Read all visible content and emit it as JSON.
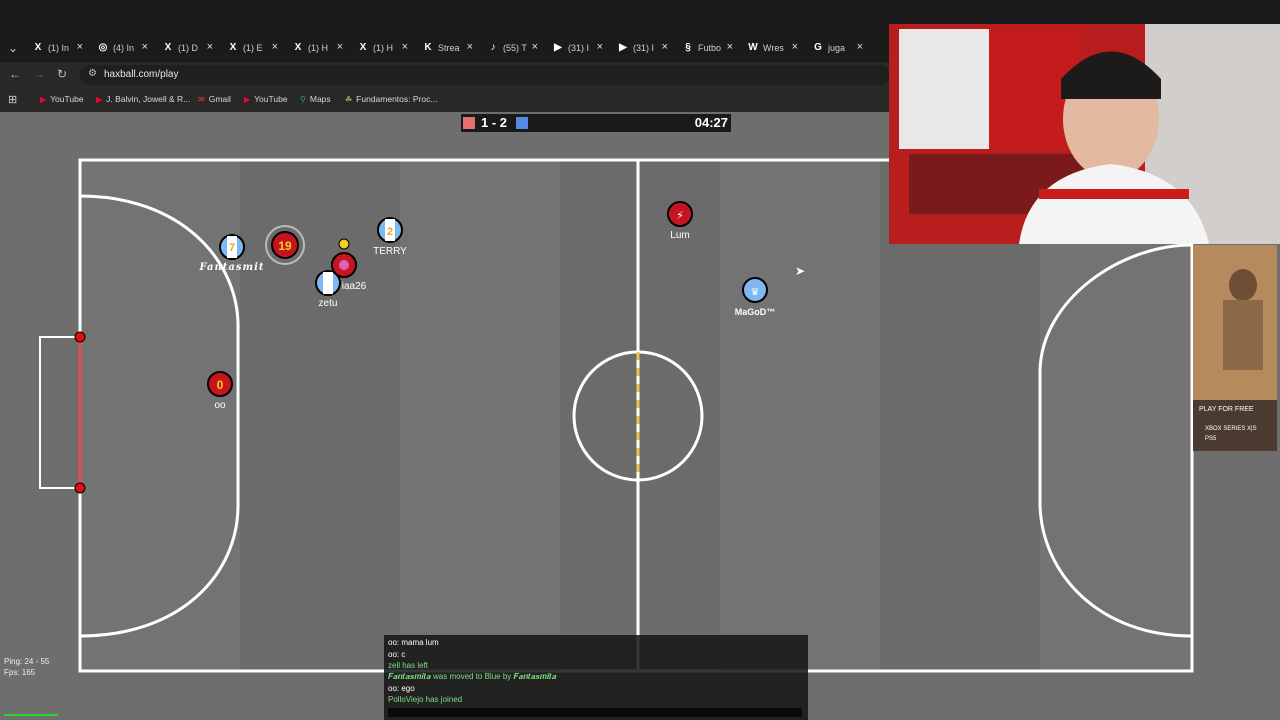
{
  "browser": {
    "tabs": [
      {
        "icon": "x-icon",
        "glyph": "X",
        "label": "(1) In"
      },
      {
        "icon": "instagram-icon",
        "glyph": "◎",
        "label": "(4) In"
      },
      {
        "icon": "x-icon",
        "glyph": "X",
        "label": "(1) D"
      },
      {
        "icon": "x-icon",
        "glyph": "X",
        "label": "(1) E"
      },
      {
        "icon": "x-icon",
        "glyph": "X",
        "label": "(1) H"
      },
      {
        "icon": "x-icon",
        "glyph": "X",
        "label": "(1) H"
      },
      {
        "icon": "kick-icon",
        "glyph": "K",
        "label": "Strea"
      },
      {
        "icon": "tiktok-icon",
        "glyph": "♪",
        "label": "(55) T"
      },
      {
        "icon": "youtube-icon",
        "glyph": "▶",
        "label": "(31) I"
      },
      {
        "icon": "youtube-icon",
        "glyph": "▶",
        "label": "(31) I"
      },
      {
        "icon": "link-icon",
        "glyph": "§",
        "label": "Futbo"
      },
      {
        "icon": "wrestling-icon",
        "glyph": "W",
        "label": "Wres"
      },
      {
        "icon": "google-icon",
        "glyph": "G",
        "label": "juga"
      }
    ],
    "url": "haxball.com/play",
    "bookmarks": [
      {
        "icon": "youtube-icon",
        "label": "YouTube"
      },
      {
        "icon": "youtube-icon",
        "label": "J. Balvin, Jowell & R..."
      },
      {
        "icon": "gmail-icon",
        "label": "Gmail"
      },
      {
        "icon": "youtube-icon",
        "label": "YouTube"
      },
      {
        "icon": "maps-icon",
        "label": "Maps"
      },
      {
        "icon": "bookmark-icon",
        "label": "Fundamentos: Proc..."
      }
    ]
  },
  "scoreboard": {
    "score": "1 - 2",
    "time": "04:27",
    "red_color": "#e56e6e",
    "blue_color": "#5689e5"
  },
  "players": [
    {
      "name": "Fantasmit",
      "team": "blue",
      "number": "7",
      "style": "italic"
    },
    {
      "name": "",
      "team": "red",
      "number": "19"
    },
    {
      "name": "TERRY",
      "team": "blue",
      "number": "2"
    },
    {
      "name": "zetu",
      "team": "blue",
      "number": ""
    },
    {
      "name": "iaa26",
      "team": "red",
      "number": ""
    },
    {
      "name": "Lum",
      "team": "red",
      "number": "⚡"
    },
    {
      "name": "MaGoD™",
      "team": "blue",
      "number": "♛",
      "style": "bold"
    },
    {
      "name": "oo",
      "team": "red",
      "number": "0"
    }
  ],
  "chat": [
    {
      "text": "oo: mama lum",
      "type": "msg"
    },
    {
      "text": "oo: c",
      "type": "msg"
    },
    {
      "text": "zell has left",
      "type": "sys"
    },
    {
      "text": "𝑭𝒂𝒏𝒕𝒂𝒔𝒎𝒊𝒕𝒂 was moved to Blue by 𝑭𝒂𝒏𝒕𝒂𝒔𝒎𝒊𝒕𝒂",
      "type": "sys"
    },
    {
      "text": "oo: ego",
      "type": "msg"
    },
    {
      "text": "PolloViejo has joined",
      "type": "sys"
    }
  ],
  "stats": {
    "ping": "Ping: 24 - 55",
    "fps": "Fps: 165"
  },
  "ad": {
    "play": "PLAY FOR FREE",
    "platform1": "XBOX SERIES X|S",
    "platform2": "PS5"
  }
}
